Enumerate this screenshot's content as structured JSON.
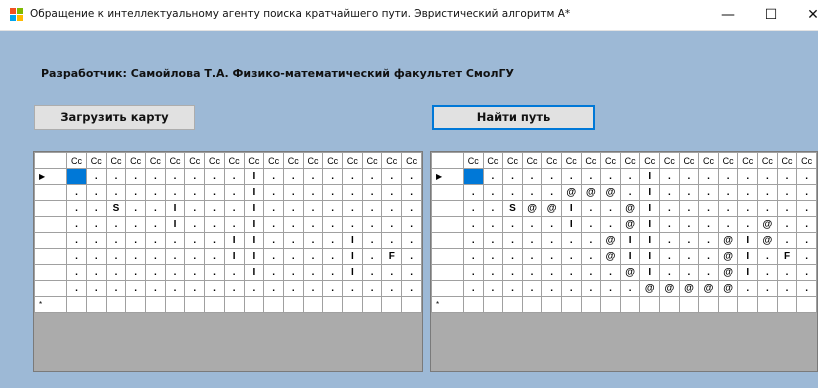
{
  "window": {
    "title": "Обращение к интеллектуальному агенту поиска кратчайшего пути. Эвристический алгоритм А*",
    "controls": {
      "minimize": "—",
      "maximize": "☐",
      "close": "✕"
    }
  },
  "developer_label": "Разработчик: Самойлова Т.А. Физико-математический факультет СмолГУ",
  "buttons": {
    "load_map": "Загрузить карту",
    "find_path": "Найти путь"
  },
  "left_grid": {
    "columns": [
      "Cc",
      "Cc",
      "Cc",
      "Cc",
      "Cc",
      "Cc",
      "Cc",
      "Cc",
      "Cc",
      "Cc",
      "Cc",
      "Cc",
      "Cc",
      "Cc",
      "Cc",
      "Cc",
      "Cc",
      "Cc"
    ],
    "row_markers": [
      "▶",
      "",
      "",
      "",
      "",
      "",
      "",
      "",
      "*"
    ],
    "rows": [
      [
        "",
        ".",
        ".",
        ".",
        ".",
        ".",
        ".",
        ".",
        ".",
        "I",
        ".",
        ".",
        ".",
        ".",
        ".",
        ".",
        ".",
        "."
      ],
      [
        ".",
        ".",
        ".",
        ".",
        ".",
        ".",
        ".",
        ".",
        ".",
        "I",
        ".",
        ".",
        ".",
        ".",
        ".",
        ".",
        ".",
        "."
      ],
      [
        ".",
        ".",
        "S",
        ".",
        ".",
        "I",
        ".",
        ".",
        ".",
        "I",
        ".",
        ".",
        ".",
        ".",
        ".",
        ".",
        ".",
        "."
      ],
      [
        ".",
        ".",
        ".",
        ".",
        ".",
        "I",
        ".",
        ".",
        ".",
        "I",
        ".",
        ".",
        ".",
        ".",
        ".",
        ".",
        ".",
        "."
      ],
      [
        ".",
        ".",
        ".",
        ".",
        ".",
        ".",
        ".",
        ".",
        "I",
        "I",
        ".",
        ".",
        ".",
        ".",
        "I",
        ".",
        ".",
        "."
      ],
      [
        ".",
        ".",
        ".",
        ".",
        ".",
        ".",
        ".",
        ".",
        "I",
        "I",
        ".",
        ".",
        ".",
        ".",
        "I",
        ".",
        "F",
        "."
      ],
      [
        ".",
        ".",
        ".",
        ".",
        ".",
        ".",
        ".",
        ".",
        ".",
        "I",
        ".",
        ".",
        ".",
        ".",
        "I",
        ".",
        ".",
        "."
      ],
      [
        ".",
        ".",
        ".",
        ".",
        ".",
        ".",
        ".",
        ".",
        ".",
        ".",
        ".",
        ".",
        ".",
        ".",
        ".",
        ".",
        ".",
        "."
      ]
    ]
  },
  "right_grid": {
    "columns": [
      "Cc",
      "Cc",
      "Cc",
      "Cc",
      "Cc",
      "Cc",
      "Cc",
      "Cc",
      "Cc",
      "Cc",
      "Cc",
      "Cc",
      "Cc",
      "Cc",
      "Cc",
      "Cc",
      "Cc",
      "Cc"
    ],
    "row_markers": [
      "▶",
      "",
      "",
      "",
      "",
      "",
      "",
      "",
      "*"
    ],
    "rows": [
      [
        "",
        ".",
        ".",
        ".",
        ".",
        ".",
        ".",
        ".",
        ".",
        "I",
        ".",
        ".",
        ".",
        ".",
        ".",
        ".",
        ".",
        "."
      ],
      [
        ".",
        ".",
        ".",
        ".",
        ".",
        "@",
        "@",
        "@",
        ".",
        "I",
        ".",
        ".",
        ".",
        ".",
        ".",
        ".",
        ".",
        "."
      ],
      [
        ".",
        ".",
        "S",
        "@",
        "@",
        "I",
        ".",
        ".",
        "@",
        "I",
        ".",
        ".",
        ".",
        ".",
        ".",
        ".",
        ".",
        "."
      ],
      [
        ".",
        ".",
        ".",
        ".",
        ".",
        "I",
        ".",
        ".",
        "@",
        "I",
        ".",
        ".",
        ".",
        ".",
        ".",
        "@",
        ".",
        "."
      ],
      [
        ".",
        ".",
        ".",
        ".",
        ".",
        ".",
        ".",
        "@",
        "I",
        "I",
        ".",
        ".",
        ".",
        "@",
        "I",
        "@",
        ".",
        "."
      ],
      [
        ".",
        ".",
        ".",
        ".",
        ".",
        ".",
        ".",
        "@",
        "I",
        "I",
        ".",
        ".",
        ".",
        "@",
        "I",
        ".",
        "F",
        "."
      ],
      [
        ".",
        ".",
        ".",
        ".",
        ".",
        ".",
        ".",
        ".",
        "@",
        "I",
        ".",
        ".",
        ".",
        "@",
        "I",
        ".",
        ".",
        "."
      ],
      [
        ".",
        ".",
        ".",
        ".",
        ".",
        ".",
        ".",
        ".",
        ".",
        "@",
        "@",
        "@",
        "@",
        "@",
        ".",
        ".",
        ".",
        "."
      ]
    ]
  }
}
